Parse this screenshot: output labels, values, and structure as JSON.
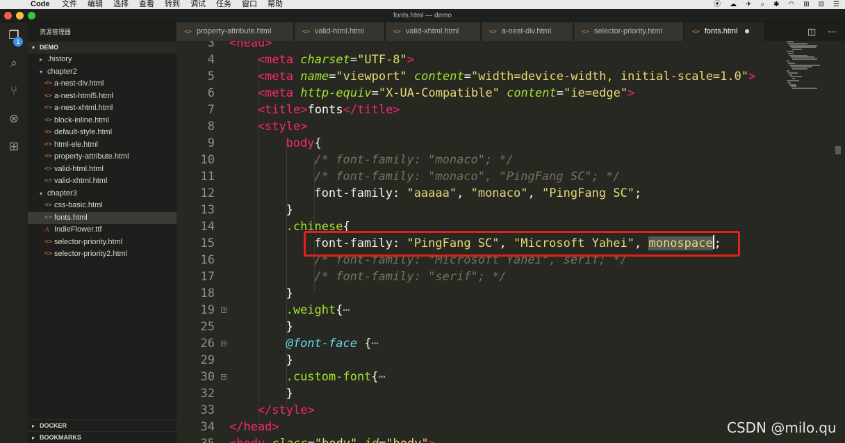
{
  "menubar": {
    "apple_glyph": "",
    "app_name": "Code",
    "menus": [
      "文件",
      "编辑",
      "选择",
      "查看",
      "转到",
      "调试",
      "任务",
      "窗口",
      "帮助"
    ],
    "status_icons": [
      "⦿",
      "☁",
      "✈",
      "⌕",
      "✱",
      "◠",
      "⊞",
      "⊟",
      "☰"
    ]
  },
  "window": {
    "title": "fonts.html — demo",
    "traffic_colors": [
      "#fc5753",
      "#fdbc40",
      "#33c748"
    ]
  },
  "activity": {
    "icons": [
      "files-icon",
      "search-icon",
      "source-control-icon",
      "debug-icon",
      "extensions-icon"
    ],
    "glyphs": [
      "❐",
      "⌕",
      "⑂",
      "⊗",
      "⊞"
    ],
    "badge": "1"
  },
  "sidebar": {
    "header": "资源管理器",
    "section": "DEMO",
    "tree": [
      {
        "label": ".history",
        "type": "folder",
        "depth": 1,
        "expanded": false
      },
      {
        "label": "chapter2",
        "type": "folder",
        "depth": 1,
        "expanded": true
      },
      {
        "label": "a-nest-div.html",
        "type": "html",
        "depth": 2
      },
      {
        "label": "a-nest-html5.html",
        "type": "html",
        "depth": 2
      },
      {
        "label": "a-nest-xhtml.html",
        "type": "html",
        "depth": 2
      },
      {
        "label": "block-inline.html",
        "type": "html",
        "depth": 2
      },
      {
        "label": "default-style.html",
        "type": "html",
        "depth": 2
      },
      {
        "label": "html-ele.html",
        "type": "html",
        "depth": 2
      },
      {
        "label": "property-attribute.html",
        "type": "html",
        "depth": 2
      },
      {
        "label": "valid-html.html",
        "type": "html",
        "depth": 2
      },
      {
        "label": "valid-xhtml.html",
        "type": "html",
        "depth": 2
      },
      {
        "label": "chapter3",
        "type": "folder",
        "depth": 1,
        "expanded": true
      },
      {
        "label": "css-basic.html",
        "type": "html",
        "depth": 2
      },
      {
        "label": "fonts.html",
        "type": "html",
        "depth": 2,
        "selected": true
      },
      {
        "label": "IndieFlower.ttf",
        "type": "ttf",
        "depth": 2
      },
      {
        "label": "selector-priority.html",
        "type": "html",
        "depth": 2
      },
      {
        "label": "selector-priority2.html",
        "type": "html",
        "depth": 2
      }
    ],
    "bottom_sections": [
      "DOCKER",
      "BOOKMARKS"
    ]
  },
  "tabs": [
    {
      "label": "property-attribute.html"
    },
    {
      "label": "valid-html.html"
    },
    {
      "label": "valid-xhtml.html"
    },
    {
      "label": "a-nest-div.html"
    },
    {
      "label": "selector-priority.html"
    },
    {
      "label": "fonts.html",
      "active": true,
      "dirty": true
    }
  ],
  "editor": {
    "file_icon_glyph": "<>",
    "split_icon_glyph": "◫",
    "more_icon_glyph": "⋯",
    "fold_glyph": "+",
    "lines": [
      {
        "n": "3",
        "indent": 0,
        "parts": [
          [
            "t",
            "<head>"
          ]
        ]
      },
      {
        "n": "4",
        "indent": 1,
        "parts": [
          [
            "t",
            "<meta "
          ],
          [
            "a",
            "charset"
          ],
          [
            "",
            "="
          ],
          [
            "s",
            "\"UTF-8\""
          ],
          [
            "t",
            ">"
          ]
        ]
      },
      {
        "n": "5",
        "indent": 1,
        "parts": [
          [
            "t",
            "<meta "
          ],
          [
            "a",
            "name"
          ],
          [
            "",
            "="
          ],
          [
            "s",
            "\"viewport\""
          ],
          [
            "",
            " "
          ],
          [
            "a",
            "content"
          ],
          [
            "",
            "="
          ],
          [
            "s",
            "\"width=device-width, initial-scale=1.0\""
          ],
          [
            "t",
            ">"
          ]
        ]
      },
      {
        "n": "6",
        "indent": 1,
        "parts": [
          [
            "t",
            "<meta "
          ],
          [
            "a",
            "http-equiv"
          ],
          [
            "",
            "="
          ],
          [
            "s",
            "\"X-UA-Compatible\""
          ],
          [
            "",
            " "
          ],
          [
            "a",
            "content"
          ],
          [
            "",
            "="
          ],
          [
            "s",
            "\"ie=edge\""
          ],
          [
            "t",
            ">"
          ]
        ]
      },
      {
        "n": "7",
        "indent": 1,
        "parts": [
          [
            "t",
            "<title>"
          ],
          [
            "",
            "fonts"
          ],
          [
            "t",
            "</title>"
          ]
        ]
      },
      {
        "n": "8",
        "indent": 1,
        "parts": [
          [
            "t",
            "<style>"
          ]
        ]
      },
      {
        "n": "9",
        "indent": 2,
        "parts": [
          [
            "t",
            "body"
          ],
          [
            "",
            "{"
          ]
        ]
      },
      {
        "n": "10",
        "indent": 3,
        "parts": [
          [
            "c",
            "/* font-family: \"monaco\"; */"
          ]
        ]
      },
      {
        "n": "11",
        "indent": 3,
        "parts": [
          [
            "c",
            "/* font-family: \"monaco\", \"PingFang SC\"; */"
          ]
        ]
      },
      {
        "n": "12",
        "indent": 3,
        "parts": [
          [
            "",
            "font-family: "
          ],
          [
            "s",
            "\"aaaaa\""
          ],
          [
            "",
            ", "
          ],
          [
            "s",
            "\"monaco\""
          ],
          [
            "",
            ", "
          ],
          [
            "s",
            "\"PingFang SC\""
          ],
          [
            "",
            ";"
          ]
        ]
      },
      {
        "n": "13",
        "indent": 2,
        "parts": [
          [
            "",
            "}"
          ]
        ]
      },
      {
        "n": "14",
        "indent": 2,
        "parts": [
          [
            "sel",
            ".chinese"
          ],
          [
            "",
            "{"
          ]
        ]
      },
      {
        "n": "15",
        "indent": 3,
        "parts": [
          [
            "",
            "font-family: "
          ],
          [
            "s",
            "\"PingFang SC\""
          ],
          [
            "",
            ", "
          ],
          [
            "s",
            "\"Microsoft Yahei\""
          ],
          [
            "",
            ", "
          ],
          [
            "hl s",
            "monospace"
          ],
          [
            "cursor",
            ""
          ],
          [
            "",
            ";"
          ]
        ]
      },
      {
        "n": "16",
        "indent": 3,
        "parts": [
          [
            "c",
            "/* font-family: \"Microsoft Yahei\", serif; */"
          ]
        ]
      },
      {
        "n": "17",
        "indent": 3,
        "parts": [
          [
            "c",
            "/* font-family: \"serif\"; */"
          ]
        ]
      },
      {
        "n": "18",
        "indent": 2,
        "parts": [
          [
            "",
            "}"
          ]
        ]
      },
      {
        "n": "19",
        "indent": 2,
        "fold": true,
        "parts": [
          [
            "sel",
            ".weight"
          ],
          [
            "",
            "{"
          ],
          [
            "ell",
            "⋯"
          ]
        ]
      },
      {
        "n": "25",
        "indent": 2,
        "parts": [
          [
            "",
            "}"
          ]
        ]
      },
      {
        "n": "26",
        "indent": 2,
        "fold": true,
        "parts": [
          [
            "k",
            "@font-face"
          ],
          [
            "",
            " {"
          ],
          [
            "ell",
            "⋯"
          ]
        ]
      },
      {
        "n": "29",
        "indent": 2,
        "parts": [
          [
            "",
            "}"
          ]
        ]
      },
      {
        "n": "30",
        "indent": 2,
        "fold": true,
        "parts": [
          [
            "sel",
            ".custom-font"
          ],
          [
            "",
            "{"
          ],
          [
            "ell",
            "⋯"
          ]
        ]
      },
      {
        "n": "32",
        "indent": 2,
        "parts": [
          [
            "",
            "}"
          ]
        ]
      },
      {
        "n": "33",
        "indent": 1,
        "parts": [
          [
            "t",
            "</style>"
          ]
        ]
      },
      {
        "n": "34",
        "indent": 0,
        "parts": [
          [
            "t",
            "</head>"
          ]
        ]
      },
      {
        "n": "35",
        "indent": 0,
        "parts": [
          [
            "t",
            "<body "
          ],
          [
            "a",
            "class"
          ],
          [
            "",
            "="
          ],
          [
            "s",
            "\"body\""
          ],
          [
            "",
            " "
          ],
          [
            "a",
            "id"
          ],
          [
            "",
            "="
          ],
          [
            "s",
            "\"body\""
          ],
          [
            "t",
            ">"
          ]
        ]
      }
    ]
  },
  "watermark": "CSDN @milo.qu"
}
